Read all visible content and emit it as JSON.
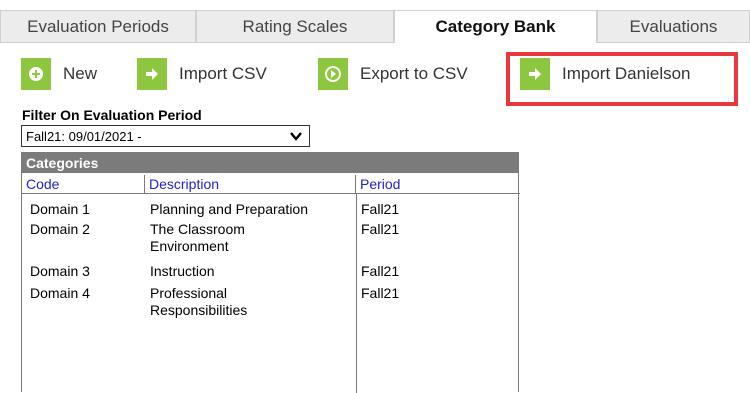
{
  "tabs": [
    {
      "label": "Evaluation Periods"
    },
    {
      "label": "Rating Scales"
    },
    {
      "label": "Category Bank",
      "active": true
    },
    {
      "label": "Evaluations"
    }
  ],
  "toolbar": {
    "new_label": "New",
    "import_csv_label": "Import CSV",
    "export_csv_label": "Export to CSV",
    "import_danielson_label": "Import Danielson"
  },
  "filter": {
    "label": "Filter On Evaluation Period",
    "selected": "Fall21: 09/01/2021 -"
  },
  "categories": {
    "title": "Categories",
    "columns": [
      "Code",
      "Description",
      "Period"
    ],
    "rows": [
      {
        "code": "Domain 1",
        "description": "Planning and Preparation",
        "period": "Fall21"
      },
      {
        "code": "Domain 2",
        "description": "The Classroom Environment",
        "period": "Fall21"
      },
      {
        "code": "Domain 3",
        "description": "Instruction",
        "period": "Fall21"
      },
      {
        "code": "Domain 4",
        "description": "Professional Responsibilities",
        "period": "Fall21"
      }
    ]
  },
  "colors": {
    "button_icon_bg": "#8dc63f",
    "highlight_border": "#e8373d",
    "panel_header_bg": "#7b7b7b",
    "column_header_text": "#2323c8"
  },
  "icons": {
    "new": "plus-circle-icon",
    "import_csv": "arrow-right-icon",
    "export_csv": "circle-arrow-icon",
    "import_danielson": "arrow-right-icon",
    "filter_dropdown": "chevron-down-icon"
  }
}
